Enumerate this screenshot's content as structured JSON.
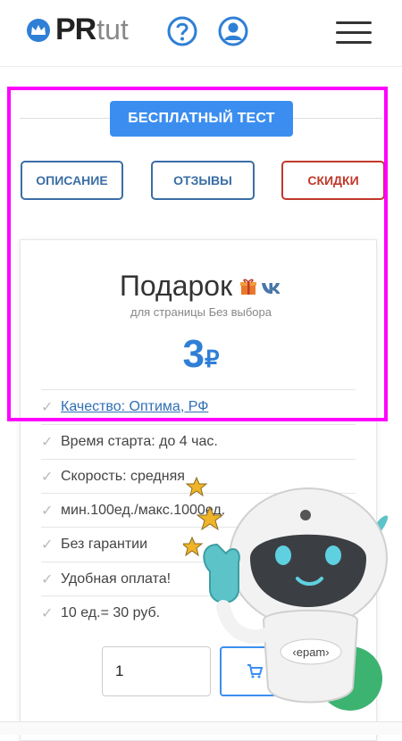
{
  "header": {
    "logo_pr": "PR",
    "logo_tut": "tut"
  },
  "main": {
    "free_test_label": "БЕСПЛАТНЫЙ ТЕСТ",
    "tabs": [
      {
        "label": "ОПИСАНИЕ"
      },
      {
        "label": "ОТЗЫВЫ"
      },
      {
        "label": "СКИДКИ"
      }
    ]
  },
  "card": {
    "title": "Подарок",
    "subtitle": "для страницы Без выбора",
    "price": "3",
    "currency": "₽",
    "features": [
      {
        "text": "Качество: Оптима, РФ",
        "link": true
      },
      {
        "text": "Время старта: до 4 час."
      },
      {
        "text": "Скорость: средняя"
      },
      {
        "text": "мин.100ед./макс.1000ед."
      },
      {
        "text": "Без гарантии"
      },
      {
        "text": "Удобная оплата!"
      },
      {
        "text": "10 ед.= 30 руб."
      }
    ],
    "quantity_value": "1"
  },
  "colors": {
    "accent": "#3b8ef0",
    "brand_blue": "#2f7fd6",
    "discount_red": "#c0392b",
    "highlight": "#ff00ff"
  },
  "overlay": {
    "robot_badge": "‹epam›"
  }
}
